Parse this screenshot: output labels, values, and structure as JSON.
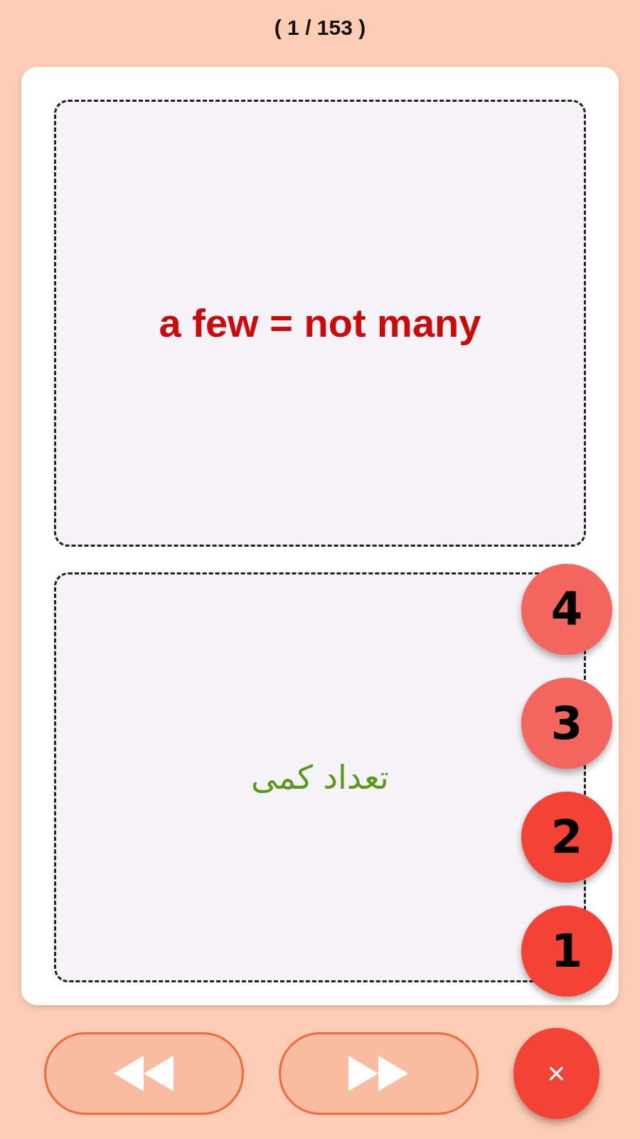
{
  "counter": "( 1 / 153 )",
  "front": {
    "text": "a few = not many"
  },
  "back": {
    "text": "تعداد کمی"
  },
  "rating_buttons": [
    {
      "label": "4",
      "dimmed": true
    },
    {
      "label": "3",
      "dimmed": true
    },
    {
      "label": "2",
      "dimmed": false
    },
    {
      "label": "1",
      "dimmed": false
    }
  ],
  "close_button": {
    "label": "×"
  }
}
